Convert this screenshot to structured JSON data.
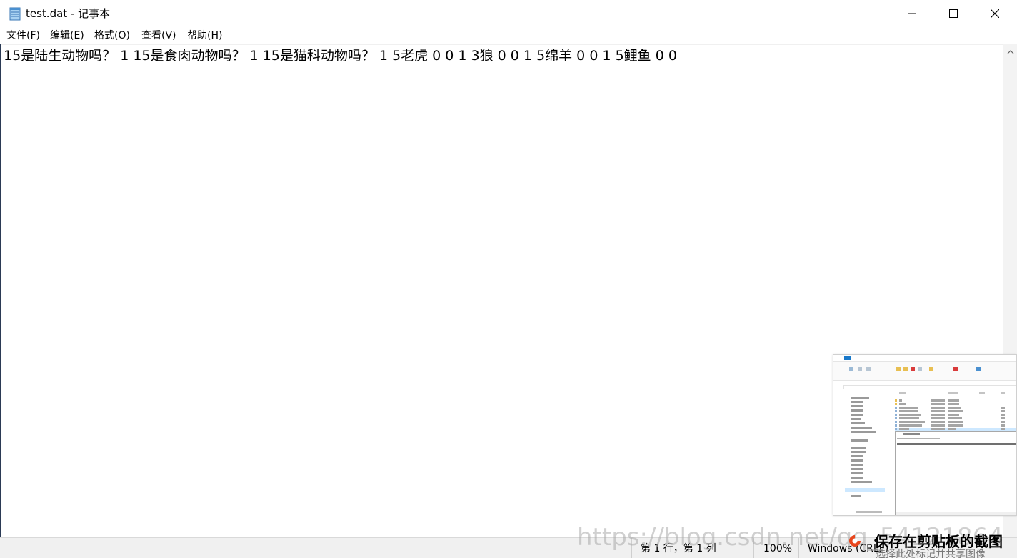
{
  "window": {
    "title": "test.dat - 记事本",
    "controls": {
      "minimize": "minimize-icon",
      "maximize": "maximize-icon",
      "close": "close-icon"
    }
  },
  "menu": {
    "items": [
      {
        "label": "文件(F)"
      },
      {
        "label": "编辑(E)"
      },
      {
        "label": "格式(O)"
      },
      {
        "label": "查看(V)"
      },
      {
        "label": "帮助(H)"
      }
    ]
  },
  "editor": {
    "content": "15是陆生动物吗？ 1 15是食肉动物吗？ 1 15是猫科动物吗？ 1 5老虎 0 0 1 3狼 0 0 1 5绵羊 0 0 1 5鲤鱼 0 0"
  },
  "status": {
    "position": "第 1 行，第 1 列",
    "zoom": "100%",
    "line_ending": "Windows (CRLF)"
  },
  "watermark": {
    "text": "https://blog.csdn.net/qq_54121864"
  },
  "screenshot_toast": {
    "title": "保存在剪贴板的截图",
    "subtitle": "选择此处标记并共享图像",
    "accent": "#e8471e"
  },
  "colors": {
    "accent": "#1979ca",
    "statusbar_bg": "#f0f0f0"
  }
}
